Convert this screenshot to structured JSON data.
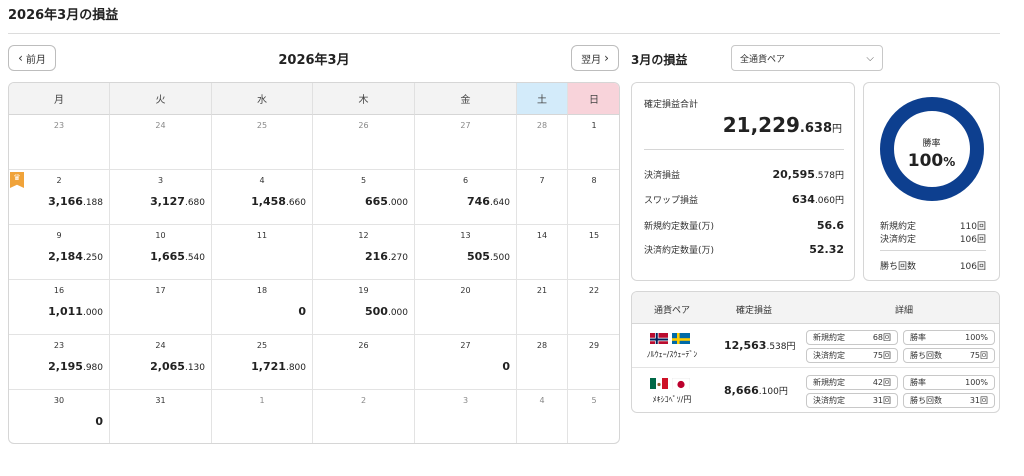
{
  "page_title": "2026年3月の損益",
  "nav": {
    "prev_label": "前月",
    "next_label": "翌月",
    "month_title": "2026年3月"
  },
  "weekdays": [
    "月",
    "火",
    "水",
    "木",
    "金",
    "土",
    "日"
  ],
  "calendar": [
    [
      {
        "day": "23",
        "other": true
      },
      {
        "day": "24",
        "other": true
      },
      {
        "day": "25",
        "other": true
      },
      {
        "day": "26",
        "other": true
      },
      {
        "day": "27",
        "other": true
      },
      {
        "day": "28",
        "other": true
      },
      {
        "day": "1"
      }
    ],
    [
      {
        "day": "2",
        "int": "3,166",
        "dec": ".188"
      },
      {
        "day": "3",
        "int": "3,127",
        "dec": ".680"
      },
      {
        "day": "4",
        "int": "1,458",
        "dec": ".660"
      },
      {
        "day": "5",
        "int": "665",
        "dec": ".000"
      },
      {
        "day": "6",
        "int": "746",
        "dec": ".640"
      },
      {
        "day": "7"
      },
      {
        "day": "8"
      }
    ],
    [
      {
        "day": "9",
        "int": "2,184",
        "dec": ".250"
      },
      {
        "day": "10",
        "int": "1,665",
        "dec": ".540"
      },
      {
        "day": "11"
      },
      {
        "day": "12",
        "int": "216",
        "dec": ".270"
      },
      {
        "day": "13",
        "int": "505",
        "dec": ".500"
      },
      {
        "day": "14"
      },
      {
        "day": "15"
      }
    ],
    [
      {
        "day": "16",
        "int": "1,011",
        "dec": ".000"
      },
      {
        "day": "17"
      },
      {
        "day": "18",
        "int": "0",
        "dec": ""
      },
      {
        "day": "19",
        "int": "500",
        "dec": ".000"
      },
      {
        "day": "20"
      },
      {
        "day": "21"
      },
      {
        "day": "22"
      }
    ],
    [
      {
        "day": "23",
        "int": "2,195",
        "dec": ".980"
      },
      {
        "day": "24",
        "int": "2,065",
        "dec": ".130"
      },
      {
        "day": "25",
        "int": "1,721",
        "dec": ".800"
      },
      {
        "day": "26"
      },
      {
        "day": "27",
        "int": "0",
        "dec": ""
      },
      {
        "day": "28"
      },
      {
        "day": "29"
      }
    ],
    [
      {
        "day": "30",
        "int": "0",
        "dec": ""
      },
      {
        "day": "31"
      },
      {
        "day": "1",
        "other": true
      },
      {
        "day": "2",
        "other": true
      },
      {
        "day": "3",
        "other": true
      },
      {
        "day": "4",
        "other": true
      },
      {
        "day": "5",
        "other": true
      }
    ]
  ],
  "side": {
    "title": "3月の損益",
    "pair_select": "全通貨ペア"
  },
  "summary": {
    "total_label": "確定損益合計",
    "total_int": "21,229",
    "total_dec": ".638",
    "unit": "円",
    "rows": [
      {
        "label": "決済損益",
        "int": "20,595",
        "dec": ".578",
        "unit": "円"
      },
      {
        "label": "スワップ損益",
        "int": "634",
        "dec": ".060",
        "unit": "円"
      },
      {
        "label": "新規約定数量(万)",
        "int": "56.6",
        "dec": "",
        "unit": ""
      },
      {
        "label": "決済約定数量(万)",
        "int": "52.32",
        "dec": "",
        "unit": ""
      }
    ]
  },
  "winrate": {
    "label": "勝率",
    "value": "100",
    "pct": "%",
    "fraction": 1.0,
    "ring_color": "#0d3f8f",
    "rows": [
      {
        "label": "新規約定",
        "value": "110回"
      },
      {
        "label": "決済約定",
        "value": "106回"
      }
    ],
    "wins_label": "勝ち回数",
    "wins_value": "106回"
  },
  "pairs": {
    "headers": [
      "通貨ペア",
      "確定損益",
      "詳細"
    ],
    "rows": [
      {
        "flags": [
          "norway-flag-icon",
          "sweden-flag-icon"
        ],
        "name": "ﾉﾙｳｪｰ/ｽｳｪｰﾃﾞﾝ",
        "profit_int": "12,563",
        "profit_dec": ".538",
        "unit": "円",
        "details": [
          {
            "label": "新規約定",
            "value": "68回"
          },
          {
            "label": "勝率",
            "value": "100%"
          },
          {
            "label": "決済約定",
            "value": "75回"
          },
          {
            "label": "勝ち回数",
            "value": "75回"
          }
        ]
      },
      {
        "flags": [
          "mexico-flag-icon",
          "japan-flag-icon"
        ],
        "name": "ﾒｷｼｺﾍﾟｿ/円",
        "profit_int": "8,666",
        "profit_dec": ".100",
        "unit": "円",
        "details": [
          {
            "label": "新規約定",
            "value": "42回"
          },
          {
            "label": "勝率",
            "value": "100%"
          },
          {
            "label": "決済約定",
            "value": "31回"
          },
          {
            "label": "勝ち回数",
            "value": "31回"
          }
        ]
      }
    ]
  }
}
